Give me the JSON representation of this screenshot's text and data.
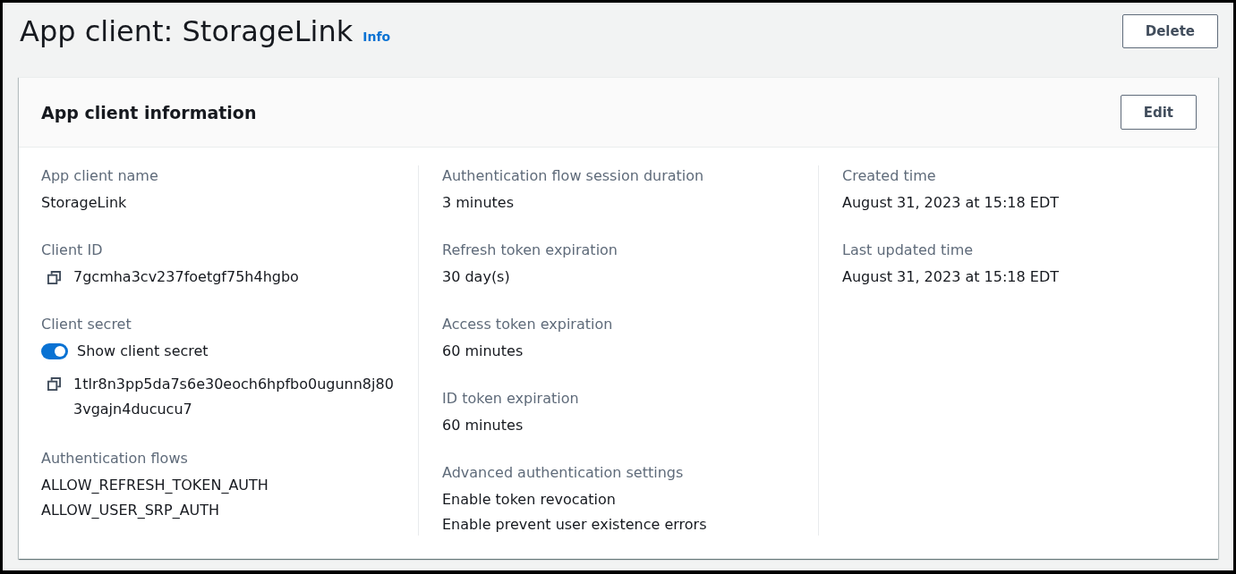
{
  "page": {
    "title": "App client: StorageLink",
    "info_link": "Info",
    "delete_button": "Delete"
  },
  "card": {
    "title": "App client information",
    "edit_button": "Edit",
    "columns": [
      {
        "fields": [
          {
            "kind": "text",
            "label": "App client name",
            "values": [
              "StorageLink"
            ]
          },
          {
            "kind": "copyable",
            "label": "Client ID",
            "values": [
              "7gcmha3cv237foetgf75h4hgbo"
            ]
          },
          {
            "kind": "secret",
            "label": "Client secret",
            "toggle": {
              "label": "Show client secret",
              "checked": true
            },
            "values": [
              "1tlr8n3pp5da7s6e30eoch6hpfbo0ugunn8j803vgajn4ducucu7"
            ]
          },
          {
            "kind": "text",
            "label": "Authentication flows",
            "values": [
              "ALLOW_REFRESH_TOKEN_AUTH",
              "ALLOW_USER_SRP_AUTH"
            ]
          }
        ]
      },
      {
        "fields": [
          {
            "kind": "text",
            "label": "Authentication flow session duration",
            "values": [
              "3 minutes"
            ]
          },
          {
            "kind": "text",
            "label": "Refresh token expiration",
            "values": [
              "30 day(s)"
            ]
          },
          {
            "kind": "text",
            "label": "Access token expiration",
            "values": [
              "60 minutes"
            ]
          },
          {
            "kind": "text",
            "label": "ID token expiration",
            "values": [
              "60 minutes"
            ]
          },
          {
            "kind": "text",
            "label": "Advanced authentication settings",
            "values": [
              "Enable token revocation",
              "Enable prevent user existence errors"
            ]
          }
        ]
      },
      {
        "fields": [
          {
            "kind": "text",
            "label": "Created time",
            "values": [
              "August 31, 2023 at 15:18 EDT"
            ]
          },
          {
            "kind": "text",
            "label": "Last updated time",
            "values": [
              "August 31, 2023 at 15:18 EDT"
            ]
          }
        ]
      }
    ]
  }
}
